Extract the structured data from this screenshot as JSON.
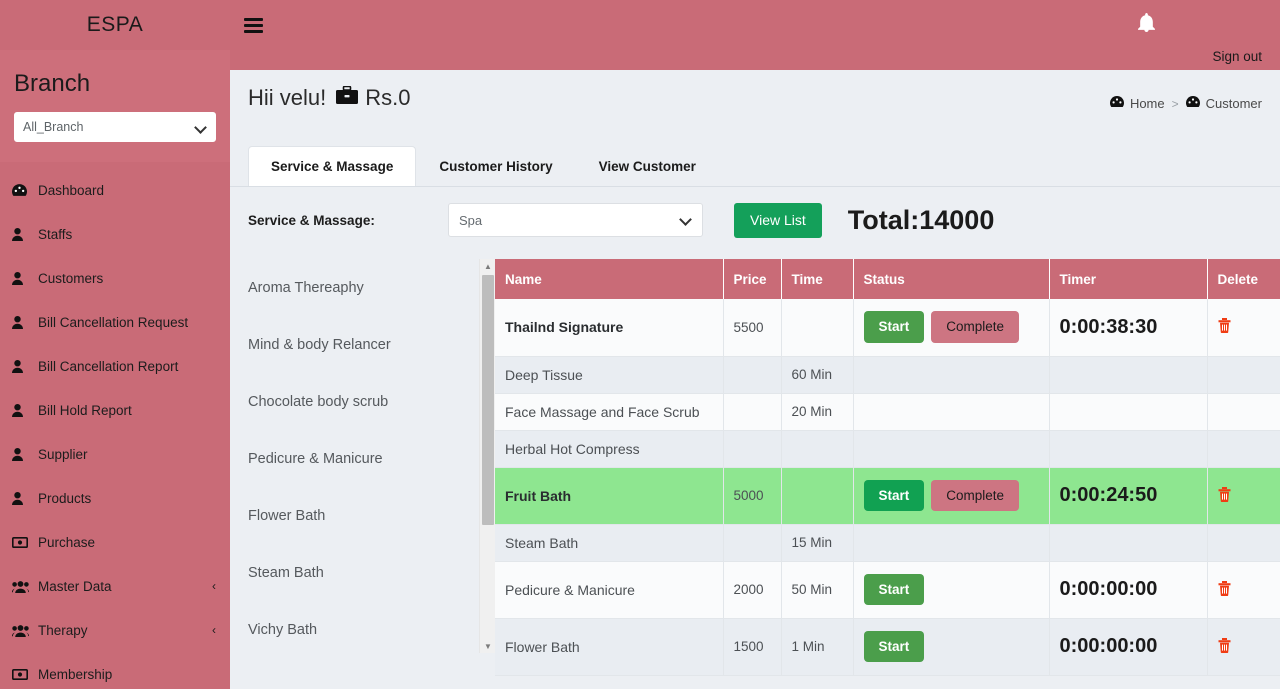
{
  "brand": {
    "name": "ESPA"
  },
  "sidebar": {
    "branch_title": "Branch",
    "branch_select_value": "All_Branch",
    "branch_options": [
      "All_Branch"
    ],
    "items": [
      {
        "label": "Dashboard",
        "icon": "dashboard-icon",
        "caret": ""
      },
      {
        "label": "Staffs",
        "icon": "user-icon",
        "caret": ""
      },
      {
        "label": "Customers",
        "icon": "user-icon",
        "caret": ""
      },
      {
        "label": "Bill Cancellation Request",
        "icon": "user-icon",
        "caret": ""
      },
      {
        "label": "Bill Cancellation Report",
        "icon": "user-icon",
        "caret": ""
      },
      {
        "label": "Bill Hold Report",
        "icon": "user-icon",
        "caret": ""
      },
      {
        "label": "Supplier",
        "icon": "user-icon",
        "caret": ""
      },
      {
        "label": "Products",
        "icon": "user-icon",
        "caret": ""
      },
      {
        "label": "Purchase",
        "icon": "money-icon",
        "caret": ""
      },
      {
        "label": "Master Data",
        "icon": "users-icon",
        "caret": "‹"
      },
      {
        "label": "Therapy",
        "icon": "users-icon",
        "caret": "‹"
      },
      {
        "label": "Membership",
        "icon": "money-icon",
        "caret": ""
      }
    ]
  },
  "topbar": {
    "menu_toggle": "hamburger-icon",
    "bell": "bell-icon",
    "signout_label": "Sign out"
  },
  "header": {
    "greeting": "Hii velu!",
    "wallet_icon": "briefcase-icon",
    "amount": "Rs.0",
    "breadcrumb": [
      {
        "label": "Home",
        "icon": "dashboard-icon"
      },
      {
        "label": "Customer",
        "icon": "dashboard-icon"
      }
    ],
    "breadcrumb_separator": ">"
  },
  "tabs": [
    {
      "label": "Service & Massage",
      "active": true
    },
    {
      "label": "Customer History",
      "active": false
    },
    {
      "label": "View Customer",
      "active": false
    }
  ],
  "controls": {
    "label": "Service & Massage:",
    "select_value": "Spa",
    "select_options": [
      "Spa"
    ],
    "view_list_label": "View List",
    "total_label": "Total:14000"
  },
  "service_list": [
    "Aroma Thereaphy",
    "Mind & body Relancer",
    "Chocolate body scrub",
    "Pedicure & Manicure",
    "Flower Bath",
    "Steam Bath",
    "Vichy Bath"
  ],
  "table": {
    "columns": [
      "Name",
      "Price",
      "Time",
      "Status",
      "Timer",
      "Delete"
    ],
    "start_label": "Start",
    "complete_label": "Complete",
    "delete_icon": "trash-icon",
    "rows": [
      {
        "name": "Thailnd Signature",
        "price": "5500",
        "time": "",
        "start": true,
        "complete": true,
        "timer": "0:00:38:30",
        "delete": true,
        "highlight": false,
        "bold": true,
        "tall": true,
        "stripe": "plain"
      },
      {
        "name": "Deep Tissue",
        "price": "",
        "time": "60 Min",
        "start": false,
        "complete": false,
        "timer": "",
        "delete": false,
        "highlight": false,
        "bold": false,
        "tall": false,
        "stripe": "striped"
      },
      {
        "name": "Face Massage and Face Scrub",
        "price": "",
        "time": "20 Min",
        "start": false,
        "complete": false,
        "timer": "",
        "delete": false,
        "highlight": false,
        "bold": false,
        "tall": false,
        "stripe": "plain"
      },
      {
        "name": "Herbal Hot Compress",
        "price": "",
        "time": "",
        "start": false,
        "complete": false,
        "timer": "",
        "delete": false,
        "highlight": false,
        "bold": false,
        "tall": false,
        "stripe": "striped"
      },
      {
        "name": "Fruit Bath",
        "price": "5000",
        "time": "",
        "start": true,
        "complete": true,
        "timer": "0:00:24:50",
        "delete": true,
        "highlight": true,
        "bold": true,
        "tall": true,
        "stripe": "plain"
      },
      {
        "name": "Steam Bath",
        "price": "",
        "time": "15 Min",
        "start": false,
        "complete": false,
        "timer": "",
        "delete": false,
        "highlight": false,
        "bold": false,
        "tall": false,
        "stripe": "striped"
      },
      {
        "name": "Pedicure & Manicure",
        "price": "2000",
        "time": "50 Min",
        "start": true,
        "complete": false,
        "timer": "0:00:00:00",
        "delete": true,
        "highlight": false,
        "bold": false,
        "tall": true,
        "stripe": "plain"
      },
      {
        "name": "Flower Bath",
        "price": "1500",
        "time": "1 Min",
        "start": true,
        "complete": false,
        "timer": "0:00:00:00",
        "delete": true,
        "highlight": false,
        "bold": false,
        "tall": true,
        "stripe": "striped"
      }
    ]
  },
  "colors": {
    "brand_pink": "#c96b77",
    "sidebar_pink": "#cd6f7b",
    "green_button": "#14a05a",
    "start_green": "#4b9e4b",
    "start_green_bright": "#11a152",
    "complete_pink": "#cd7582",
    "highlight_green": "#8ee690",
    "page_bg": "#eceff3",
    "trash_red": "#f03c14"
  }
}
